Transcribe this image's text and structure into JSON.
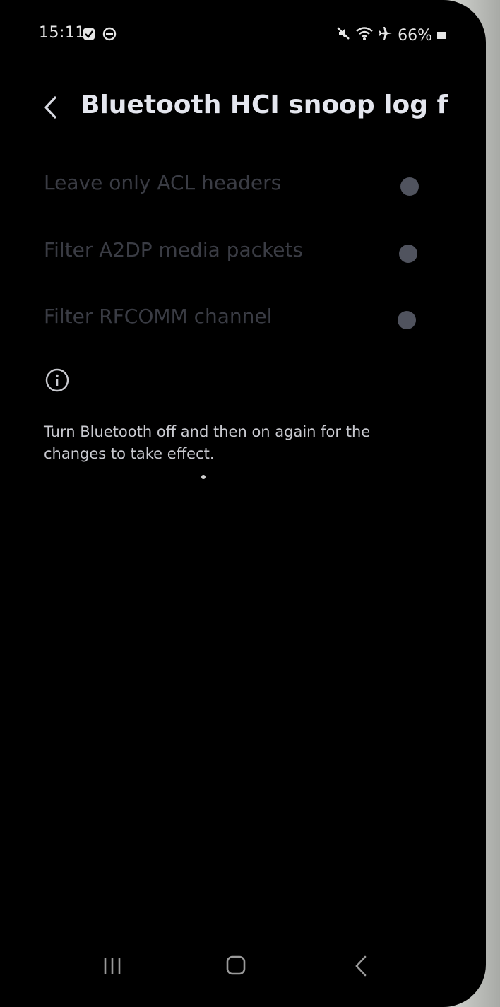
{
  "status_bar": {
    "time": "15:11",
    "battery_percent": "66%",
    "icons": [
      "checkbox-notification-icon",
      "messenger-icon",
      "mute-icon",
      "wifi-icon",
      "airplane-icon",
      "battery-icon"
    ]
  },
  "header": {
    "title": "Bluetooth HCI snoop log fil..."
  },
  "options": [
    {
      "label": "Leave only ACL headers",
      "selected": false
    },
    {
      "label": "Filter A2DP media packets",
      "selected": false
    },
    {
      "label": "Filter RFCOMM channel",
      "selected": false
    }
  ],
  "info": {
    "text_line1": "Turn Bluetooth off and then on again for the",
    "text_line2": "changes to take effect."
  },
  "colors": {
    "background": "#000000",
    "title": "#e4e6ee",
    "disabled_label": "#3a3c44",
    "radio_disabled": "#50535e"
  }
}
